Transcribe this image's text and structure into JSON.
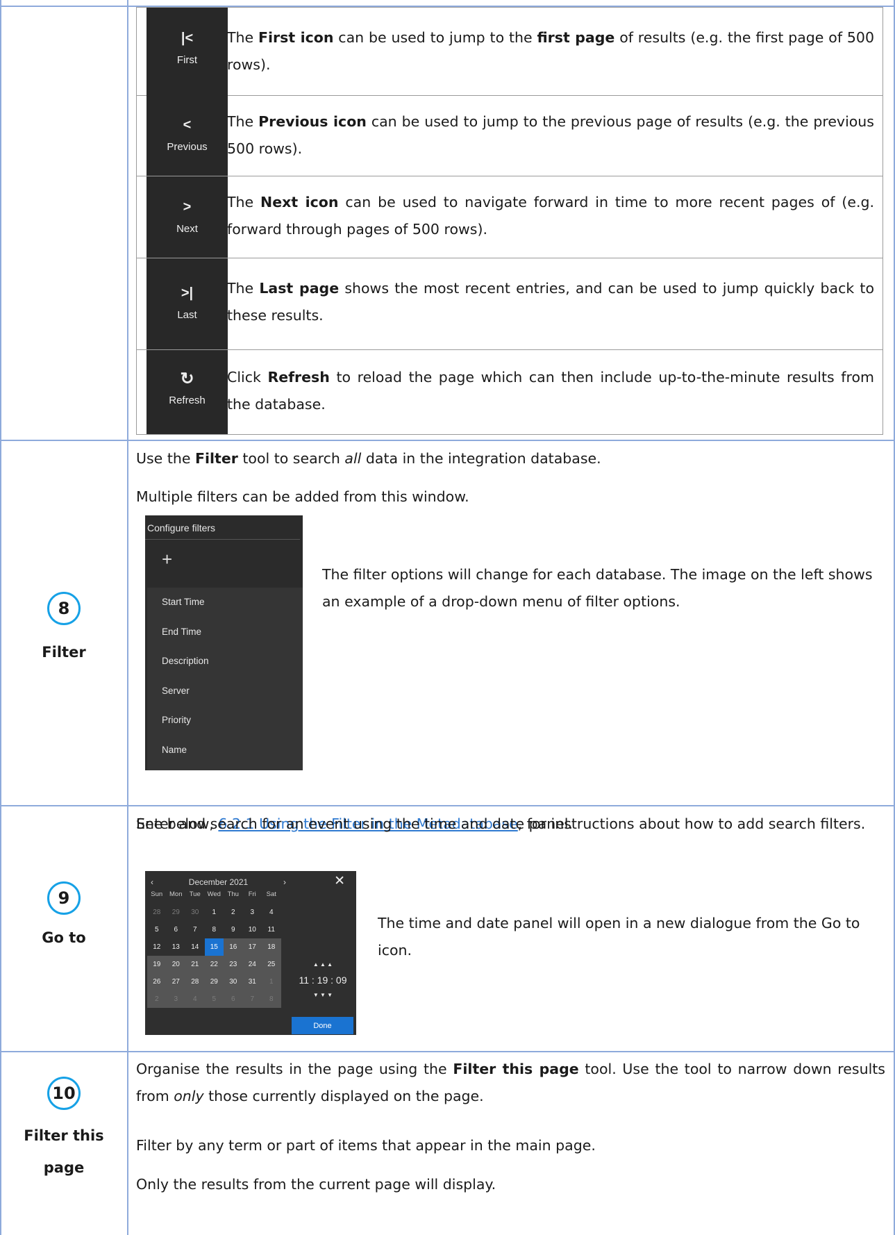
{
  "nav_rows": [
    {
      "glyph": "|<",
      "label": "First",
      "icon": "first-page-icon",
      "parts": [
        "The ",
        "First icon",
        " can be used to jump to the ",
        "first page",
        " of results (e.g. the first page of 500 rows)."
      ]
    },
    {
      "glyph": "<",
      "label": "Previous",
      "icon": "previous-page-icon",
      "parts": [
        "The ",
        "Previous icon",
        " can be used to jump to the previous page of results (e.g. the previous 500 rows)."
      ]
    },
    {
      "glyph": ">",
      "label": "Next",
      "icon": "next-page-icon",
      "parts": [
        "The ",
        "Next icon",
        " can be used to navigate forward in time to more recent pages of (e.g. forward through pages of 500 rows)."
      ]
    },
    {
      "glyph": ">|",
      "label": "Last",
      "icon": "last-page-icon",
      "parts": [
        "The ",
        "Last page",
        " shows the most recent entries, and can be used to jump quickly back to these results."
      ]
    },
    {
      "glyph": "↻",
      "label": "Refresh",
      "icon": "refresh-icon",
      "parts": [
        "Click ",
        "Refresh",
        " to reload the page which can then include up-to-the-minute results from the database."
      ]
    }
  ],
  "filter": {
    "number": "8",
    "label": "Filter",
    "p1_pre": "Use the ",
    "p1_bold": "Filter",
    "p1_mid": " tool to search ",
    "p1_italic": "all",
    "p1_post": " data in the integration database.",
    "p2": "Multiple filters can be added from this window.",
    "panel_title": "Configure filters",
    "panel_plus": "+",
    "panel_items": [
      "Start Time",
      "End Time",
      "Description",
      "Server",
      "Priority",
      "Name"
    ],
    "side_text": "The filter options will change for each database. The image on the left shows an example of a drop-down menu of filter options.",
    "see_pre": "See below, ",
    "see_link": "6.2.1 Using the Filter in the Metadatabase",
    "see_post": ", for instructions about how to add search filters."
  },
  "goto": {
    "number": "9",
    "label": "Go to",
    "p1": "Enter and search for an event using the time and date panel.",
    "side_text": "The time and date panel will open in a new dialogue from the Go to icon.",
    "calendar": {
      "prev": "‹",
      "month": "December 2021",
      "next": "›",
      "close": "✕",
      "weekdays": [
        "Sun",
        "Mon",
        "Tue",
        "Wed",
        "Thu",
        "Fri",
        "Sat"
      ],
      "days": [
        "28",
        "29",
        "30",
        "1",
        "2",
        "3",
        "4",
        "5",
        "6",
        "7",
        "8",
        "9",
        "10",
        "11",
        "12",
        "13",
        "14",
        "15",
        "16",
        "17",
        "18",
        "19",
        "20",
        "21",
        "22",
        "23",
        "24",
        "25",
        "26",
        "27",
        "28",
        "29",
        "30",
        "31",
        "1",
        "2",
        "3",
        "4",
        "5",
        "6",
        "7",
        "8"
      ],
      "time": "11 : 19 : 09",
      "up_arrows": "▲ ▲ ▲",
      "down_arrows": "▼ ▼ ▼",
      "done": "Done"
    }
  },
  "filter_page": {
    "number": "10",
    "label_line1": "Filter this",
    "label_line2": "page",
    "p1_pre": "Organise the results in the page using the ",
    "p1_bold": "Filter this page",
    "p1_mid": " tool. Use the tool to narrow down results from ",
    "p1_italic": "only",
    "p1_post": " those currently displayed on the page.",
    "p2": "Filter by any term or part of items that appear in the main page.",
    "p3": "Only the results from the current page will display."
  }
}
